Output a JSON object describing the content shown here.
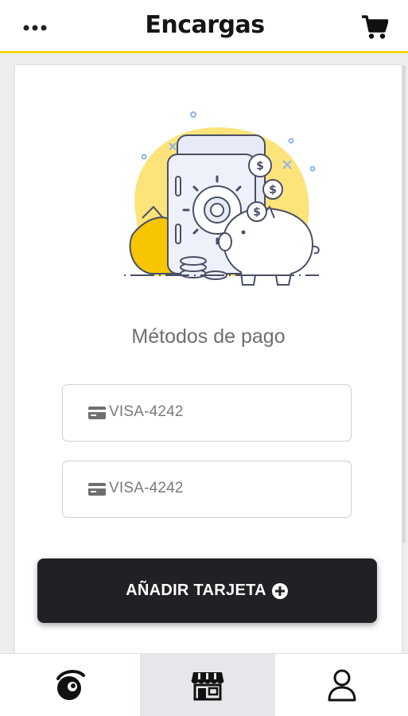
{
  "header": {
    "menu_icon": "more-dots-icon",
    "logo_text": "Encargas",
    "cart_icon": "shopping-cart-icon",
    "accent_color": "#f2d60c"
  },
  "main": {
    "illustration": "piggy-bank-safe-illustration",
    "title": "Métodos de pago",
    "payment_methods": [
      {
        "icon": "credit-card-icon",
        "label": "VISA-4242"
      },
      {
        "icon": "credit-card-icon",
        "label": "VISA-4242"
      }
    ],
    "add_card_button": {
      "label": "AÑADIR TARJETA",
      "icon": "plus-circle-icon"
    }
  },
  "bottom_nav": {
    "items": [
      {
        "name": "home",
        "icon": "logo-mark-icon",
        "active": false
      },
      {
        "name": "store",
        "icon": "store-icon",
        "active": true
      },
      {
        "name": "profile",
        "icon": "user-icon",
        "active": false
      }
    ]
  }
}
